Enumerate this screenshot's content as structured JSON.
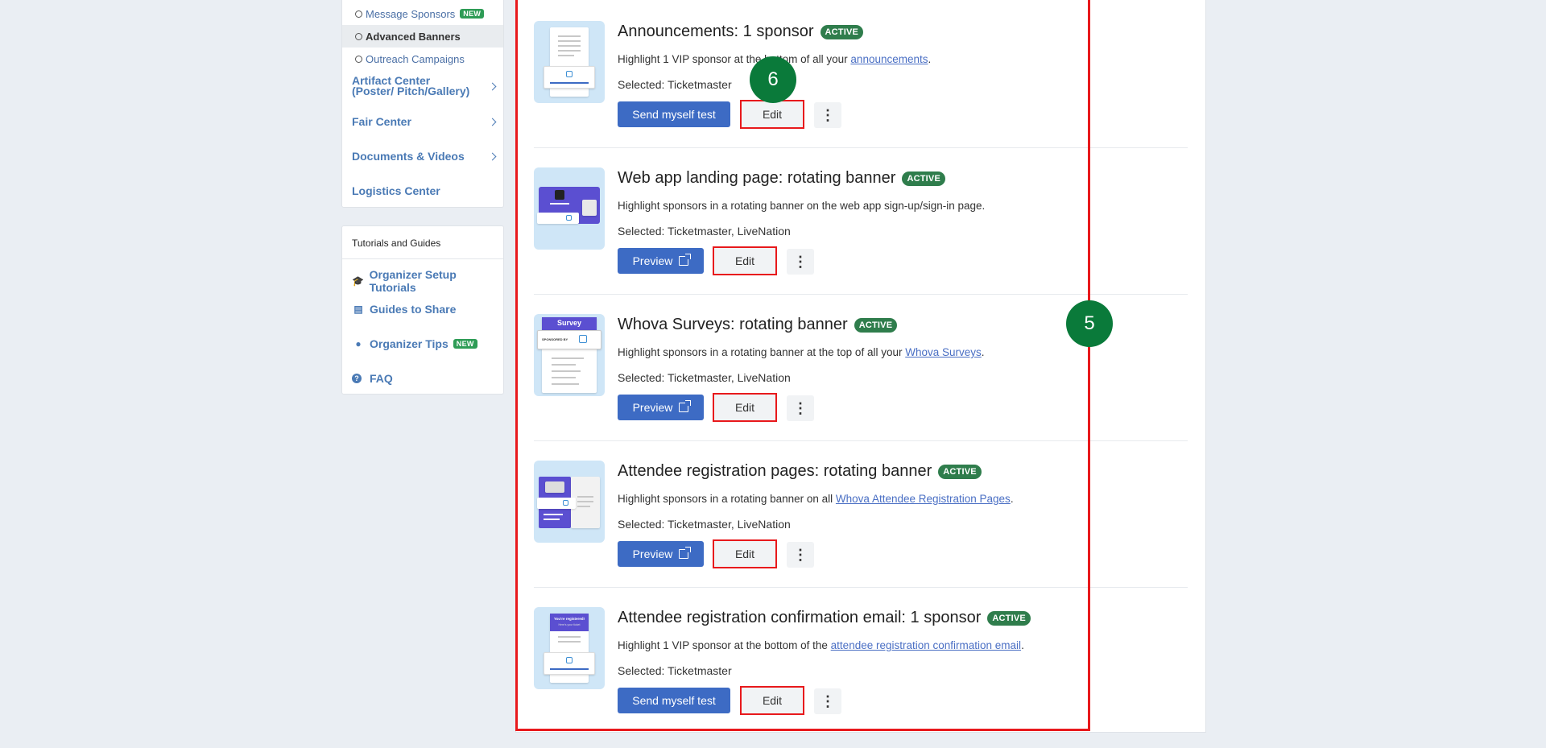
{
  "sidebar": {
    "sub_items": [
      {
        "label": "Message Sponsors",
        "badge": "NEW"
      },
      {
        "label": "Advanced Banners",
        "active": true
      },
      {
        "label": "Outreach Campaigns"
      }
    ],
    "nav_items": [
      {
        "label": "Artifact Center (Poster/ Pitch/Gallery)",
        "has_chevron": true
      },
      {
        "label": "Fair Center",
        "has_chevron": true
      },
      {
        "label": "Documents & Videos",
        "has_chevron": true
      },
      {
        "label": "Logistics Center",
        "has_chevron": false
      }
    ],
    "tutorials": {
      "title": "Tutorials and Guides",
      "items": [
        {
          "label": "Organizer Setup Tutorials",
          "icon": "graduation-cap-icon"
        },
        {
          "label": "Guides to Share",
          "icon": "presentation-icon"
        },
        {
          "label": "Organizer Tips",
          "icon": "lightbulb-icon",
          "badge": "NEW"
        },
        {
          "label": "FAQ",
          "icon": "question-circle-icon"
        }
      ]
    }
  },
  "cards": [
    {
      "title": "Announcements: 1 sponsor",
      "status": "ACTIVE",
      "desc_prefix": "Highlight 1 VIP sponsor at the bottom of all your ",
      "desc_link": "announcements",
      "desc_suffix": ".",
      "selected": "Selected: Ticketmaster",
      "primary_label": "Send myself test",
      "edit_label": "Edit"
    },
    {
      "title": "Web app landing page: rotating banner",
      "status": "ACTIVE",
      "desc_prefix": "Highlight sponsors in a rotating banner on the web app sign-up/sign-in page.",
      "desc_link": "",
      "desc_suffix": "",
      "selected": "Selected: Ticketmaster, LiveNation",
      "primary_label": "Preview",
      "edit_label": "Edit"
    },
    {
      "title": "Whova Surveys: rotating banner",
      "status": "ACTIVE",
      "desc_prefix": "Highlight sponsors in a rotating banner at the top of all your ",
      "desc_link": "Whova Surveys",
      "desc_suffix": ".",
      "selected": "Selected: Ticketmaster, LiveNation",
      "primary_label": "Preview",
      "edit_label": "Edit"
    },
    {
      "title": "Attendee registration pages: rotating banner",
      "status": "ACTIVE",
      "desc_prefix": "Highlight sponsors in a rotating banner on all ",
      "desc_link": "Whova Attendee Registration Pages",
      "desc_suffix": ".",
      "selected": "Selected: Ticketmaster, LiveNation",
      "primary_label": "Preview",
      "edit_label": "Edit"
    },
    {
      "title": "Attendee registration confirmation email: 1 sponsor",
      "status": "ACTIVE",
      "desc_prefix": "Highlight 1 VIP sponsor at the bottom of the ",
      "desc_link": "attendee registration confirmation email",
      "desc_suffix": ".",
      "selected": "Selected: Ticketmaster",
      "primary_label": "Send myself test",
      "edit_label": "Edit"
    }
  ],
  "thumb_text": {
    "survey": "Survey",
    "sponsored_by": "SPONSORED BY",
    "registered": "You're registered!",
    "registered_sub": "Here's your ticket"
  },
  "annotations": {
    "marker_5": "5",
    "marker_6": "6"
  },
  "colors": {
    "primary": "#3d6bc4",
    "active_badge": "#2f7d4c",
    "new_badge": "#2e9c56",
    "highlight": "#e8191c",
    "marker": "#0a7a3a"
  }
}
